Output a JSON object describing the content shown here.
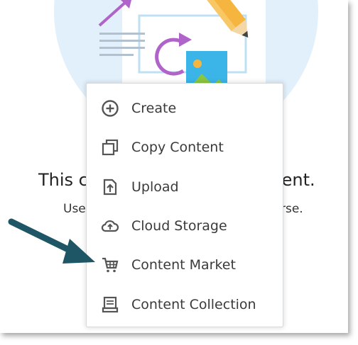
{
  "empty_state": {
    "title_left": "This c",
    "title_right": "ntent.",
    "subtitle_left": "Use",
    "subtitle_right": "rse."
  },
  "menu": {
    "items": [
      {
        "label": "Create",
        "icon": "plus-circle-icon"
      },
      {
        "label": "Copy Content",
        "icon": "copy-icon"
      },
      {
        "label": "Upload",
        "icon": "upload-icon"
      },
      {
        "label": "Cloud Storage",
        "icon": "cloud-upload-icon"
      },
      {
        "label": "Content Market",
        "icon": "cart-icon"
      },
      {
        "label": "Content Collection",
        "icon": "collection-icon"
      }
    ]
  },
  "colors": {
    "hero_bg": "#e2f0fb",
    "icon_gray": "#555555",
    "callout_arrow": "#1f5666",
    "pencil": "#f6b53f",
    "refresh": "#b063c9",
    "image_tile": "#3bb5e8"
  }
}
